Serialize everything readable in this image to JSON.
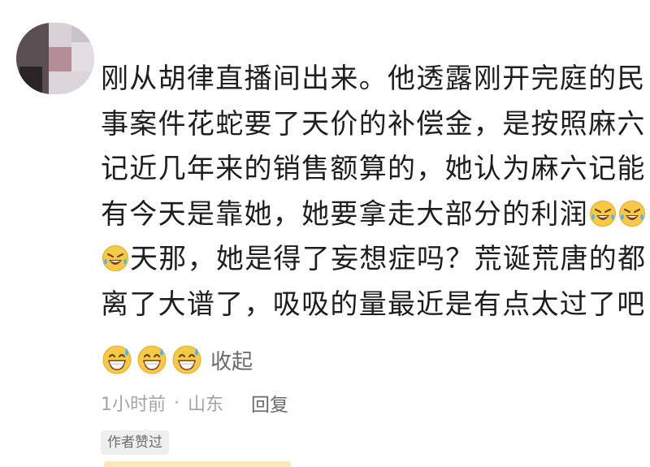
{
  "comment": {
    "lines": [
      "刚从胡律直播间出来。他透露刚开完庭的民",
      "事案件花蛇要了天价的补偿金，是按照麻六",
      "记近几年来的销售额算的，她认为麻六记能",
      "有今天是靠她，她要拿走大部分的利润",
      "天那，她是得了妄想症吗？荒诞荒唐的都",
      "离了大谱了，吸吸的量最近是有点太过了吧"
    ],
    "emoji_line4": [
      "rofl-emoji",
      "rofl-emoji"
    ],
    "emoji_line5": [
      "rofl-emoji"
    ],
    "trailing_emoji": [
      "grin-sweat-emoji",
      "grin-sweat-emoji",
      "grin-sweat-emoji"
    ]
  },
  "collapse_label": "收起",
  "meta": {
    "time": "1小时前",
    "separator": "·",
    "location": "山东",
    "reply_label": "回复"
  },
  "author_liked_badge": "作者赞过",
  "colors": {
    "text": "#1e1e1e",
    "secondary": "#6a6a6a",
    "muted": "#a4a4a4",
    "badge_bg": "#efefef",
    "emoji_face": "#f7c948"
  }
}
